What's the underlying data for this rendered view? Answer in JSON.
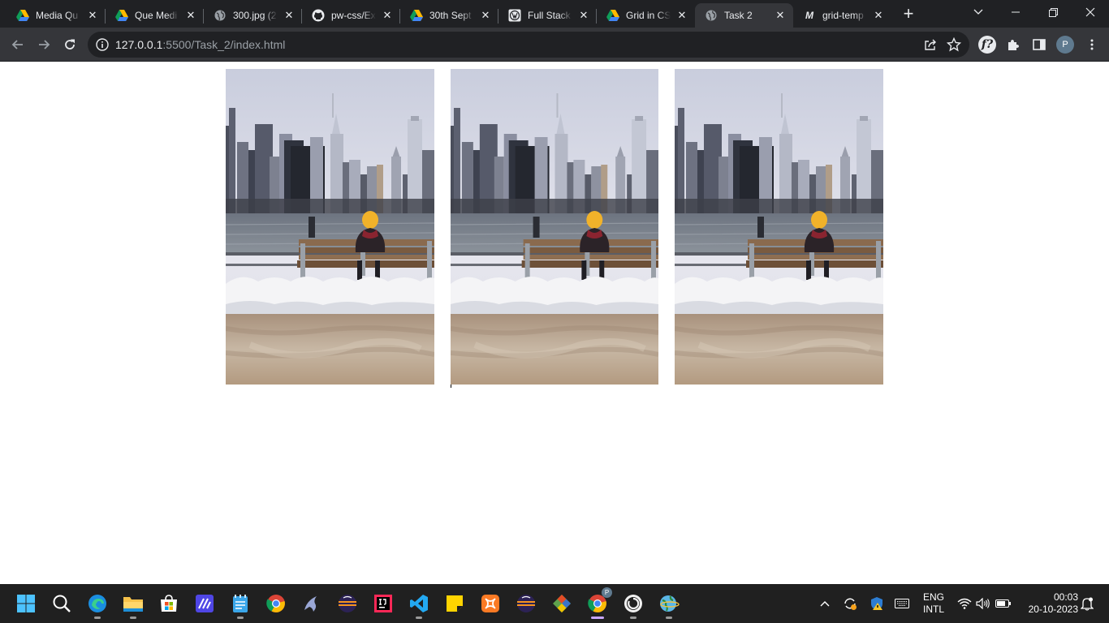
{
  "browser": {
    "tabs": [
      {
        "title": "Media Qu",
        "icon": "google-drive-icon"
      },
      {
        "title": "Que Medi",
        "icon": "google-drive-icon"
      },
      {
        "title": "300.jpg (2",
        "icon": "globe-icon"
      },
      {
        "title": "pw-css/Ex",
        "icon": "github-icon"
      },
      {
        "title": "30th Sept",
        "icon": "google-drive-icon"
      },
      {
        "title": "Full Stack",
        "icon": "wordpress-icon"
      },
      {
        "title": "Grid in CS",
        "icon": "google-drive-icon"
      },
      {
        "title": "Task 2",
        "icon": "globe-icon",
        "active": true
      },
      {
        "title": "grid-temp",
        "icon": "mdn-icon"
      }
    ],
    "address": {
      "host": "127.0.0.1",
      "rest": ":5500/Task_2/index.html"
    },
    "profile_initial": "P",
    "extension_label": "f?"
  },
  "page": {
    "images": [
      {
        "alt": "city skyline with person on bench"
      },
      {
        "alt": "city skyline with person on bench"
      },
      {
        "alt": "city skyline with person on bench"
      }
    ]
  },
  "taskbar": {
    "language_line1": "ENG",
    "language_line2": "INTL",
    "time": "00:03",
    "date": "20-10-2023",
    "badge": "P"
  },
  "colors": {
    "tabstrip": "#202124",
    "toolbar": "#35363a",
    "taskbar": "#202020"
  }
}
